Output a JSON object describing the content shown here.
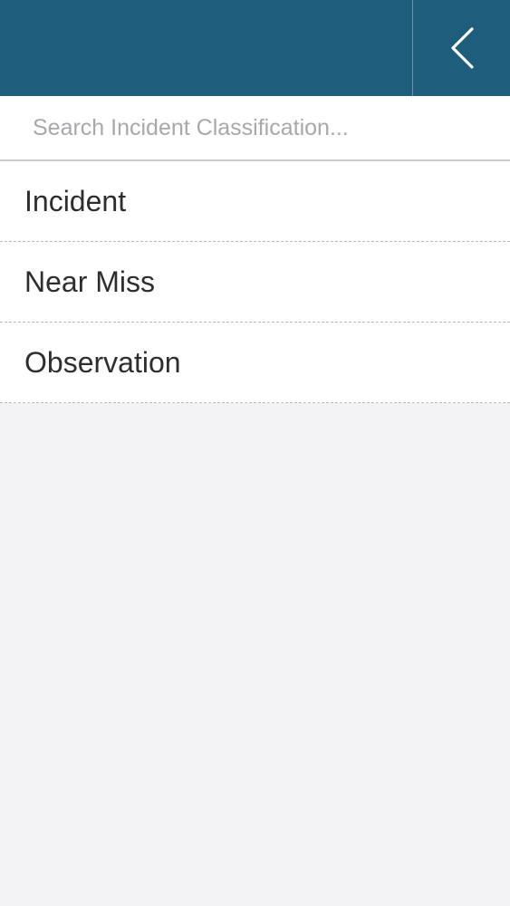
{
  "header": {
    "back_icon": "chevron-left-icon",
    "color": "#1f5d7c"
  },
  "search": {
    "placeholder": "Search Incident Classification...",
    "value": ""
  },
  "classifications": [
    {
      "label": "Incident"
    },
    {
      "label": "Near Miss"
    },
    {
      "label": "Observation"
    }
  ]
}
